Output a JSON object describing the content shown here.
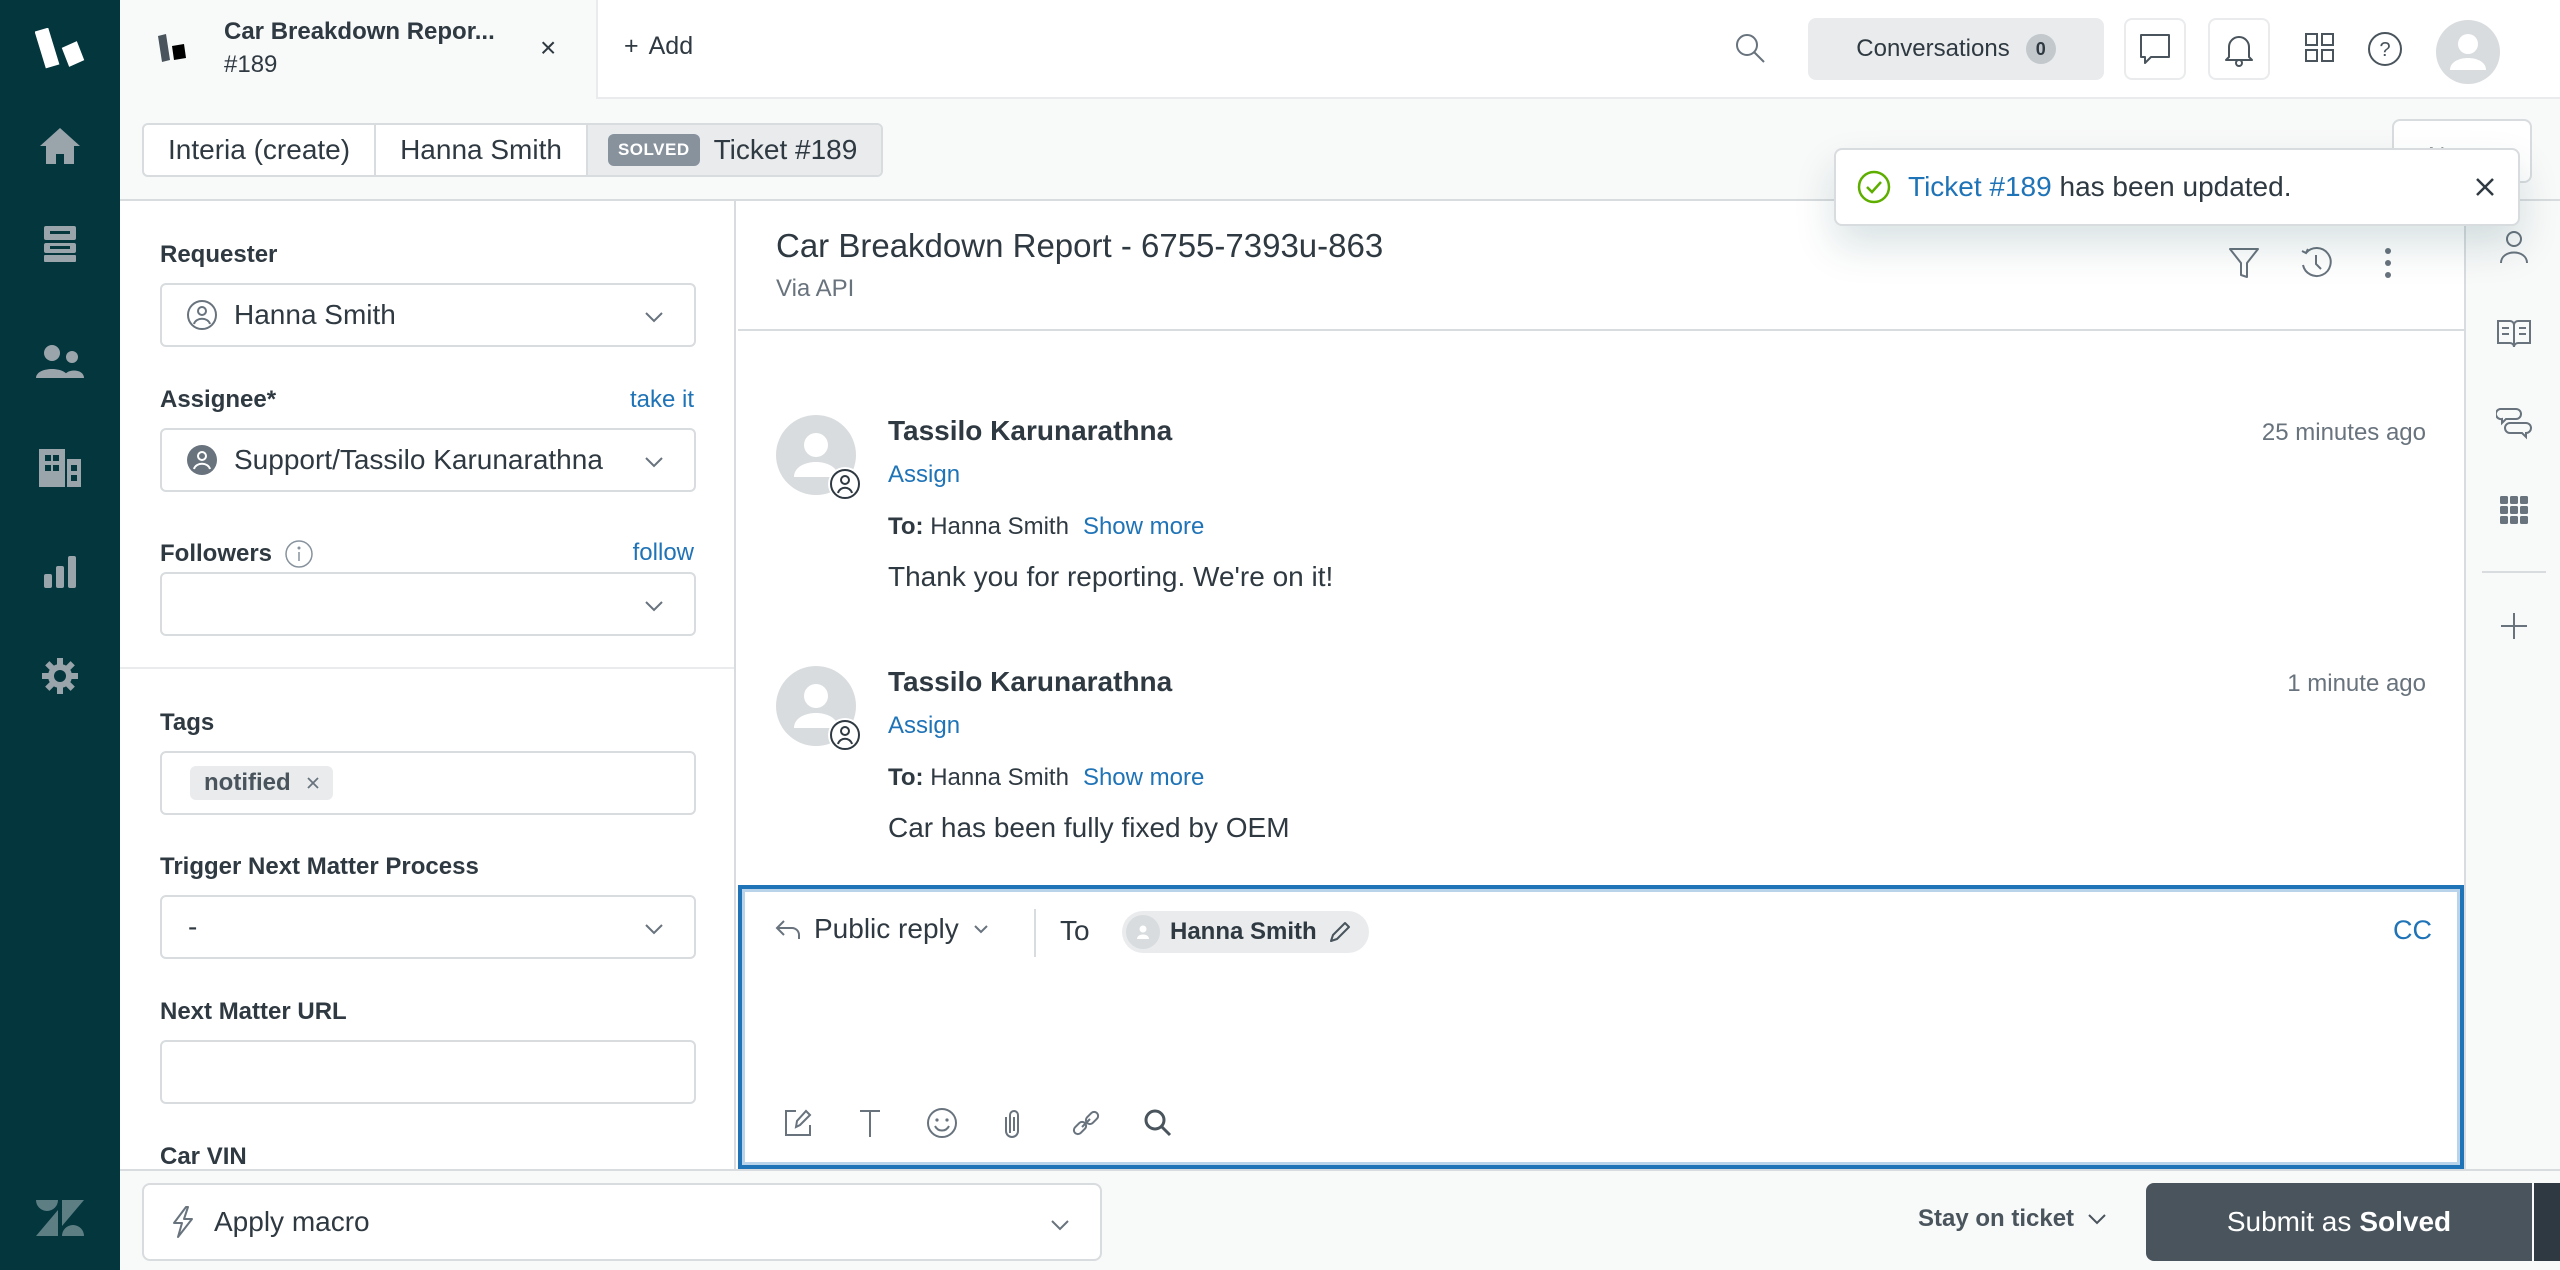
{
  "nav": {
    "items": [
      {
        "name": "home",
        "icon": "home-icon"
      },
      {
        "name": "views",
        "icon": "inbox-icon"
      },
      {
        "name": "customers",
        "icon": "users-icon"
      },
      {
        "name": "organizations",
        "icon": "building-icon"
      },
      {
        "name": "reporting",
        "icon": "bar-chart-icon"
      },
      {
        "name": "admin",
        "icon": "gear-icon"
      }
    ]
  },
  "topbar": {
    "tab_title": "Car Breakdown Repor...",
    "tab_subtitle": "#189",
    "add_label": "Add",
    "conversations_label": "Conversations",
    "conversations_count": "0"
  },
  "breadcrumbs": {
    "items": [
      "Interia (create)",
      "Hanna Smith"
    ],
    "status_badge": "SOLVED",
    "ticket": "Ticket #189",
    "next_label": "Next"
  },
  "toast": {
    "link_text": "Ticket #189",
    "message": " has been updated."
  },
  "properties": {
    "requester_label": "Requester",
    "requester_value": "Hanna Smith",
    "assignee_label": "Assignee*",
    "assignee_action": "take it",
    "assignee_value": "Support/Tassilo Karunarathna",
    "followers_label": "Followers",
    "followers_action": "follow",
    "followers_value": "",
    "tags_label": "Tags",
    "tags": [
      "notified"
    ],
    "trigger_label": "Trigger Next Matter Process",
    "trigger_value": "-",
    "url_label": "Next Matter URL",
    "url_value": "",
    "vin_label": "Car VIN"
  },
  "ticket": {
    "title": "Car Breakdown Report - 6755-7393u-863",
    "via": "Via API"
  },
  "messages": [
    {
      "author": "Tassilo Karunarathna",
      "assign_label": "Assign",
      "to_label": "To:",
      "to_value": "Hanna Smith",
      "show_more": "Show more",
      "body": "Thank you for reporting. We're on it!",
      "time": "25 minutes ago"
    },
    {
      "author": "Tassilo Karunarathna",
      "assign_label": "Assign",
      "to_label": "To:",
      "to_value": "Hanna Smith",
      "show_more": "Show more",
      "body": "Car has been fully fixed by OEM",
      "time": "1 minute ago"
    }
  ],
  "composer": {
    "reply_type": "Public reply",
    "to_label": "To",
    "recipient": "Hanna Smith",
    "cc_label": "CC",
    "body": ""
  },
  "footer": {
    "macro_label": "Apply macro",
    "stay_label": "Stay on ticket",
    "submit_prefix": "Submit as",
    "submit_status": "Solved"
  },
  "colors": {
    "nav_bg": "#03363d",
    "link": "#1f73b7",
    "submit_bg": "#49545c",
    "submit_more_bg": "#2f3941",
    "success": "#5eae00"
  }
}
